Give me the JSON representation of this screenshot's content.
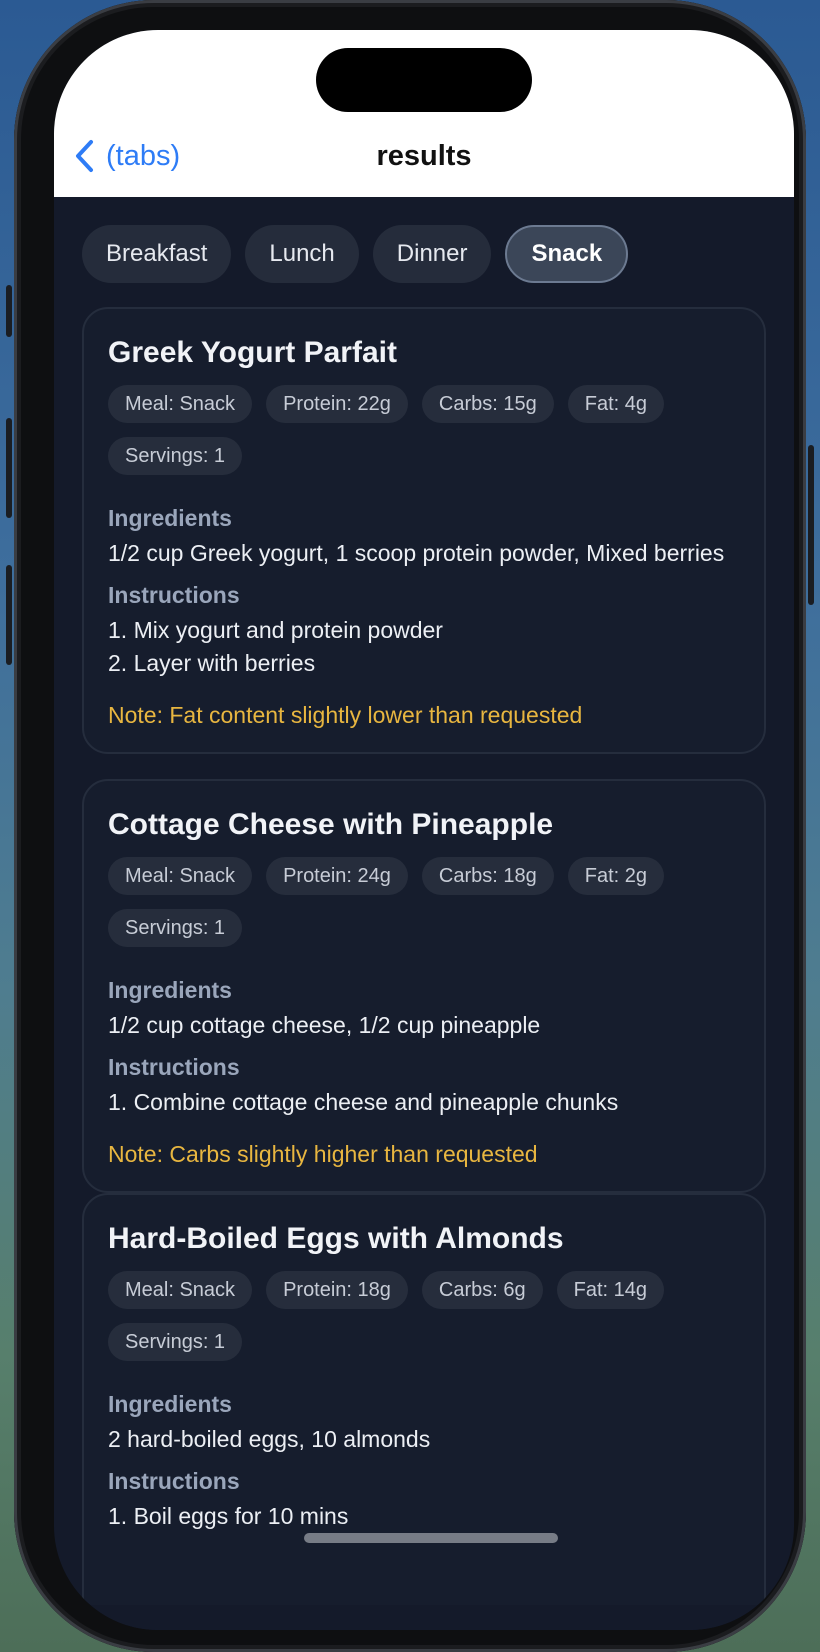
{
  "nav": {
    "back_label": "(tabs)",
    "title": "results"
  },
  "tabs": [
    {
      "label": "Breakfast",
      "active": false
    },
    {
      "label": "Lunch",
      "active": false
    },
    {
      "label": "Dinner",
      "active": false
    },
    {
      "label": "Snack",
      "active": true
    }
  ],
  "cards": [
    {
      "title": "Greek Yogurt Parfait",
      "chips": [
        "Meal: Snack",
        "Protein: 22g",
        "Carbs: 15g",
        "Fat: 4g",
        "Servings: 1"
      ],
      "ingredients_heading": "Ingredients",
      "ingredients": "1/2 cup Greek yogurt, 1 scoop protein powder, Mixed berries",
      "instructions_heading": "Instructions",
      "instructions": [
        "1. Mix yogurt and protein powder",
        "2. Layer with berries"
      ],
      "note": "Note: Fat content slightly lower than requested"
    },
    {
      "title": "Cottage Cheese with Pineapple",
      "chips": [
        "Meal: Snack",
        "Protein: 24g",
        "Carbs: 18g",
        "Fat: 2g",
        "Servings: 1"
      ],
      "ingredients_heading": "Ingredients",
      "ingredients": "1/2 cup cottage cheese, 1/2 cup pineapple",
      "instructions_heading": "Instructions",
      "instructions": [
        "1. Combine cottage cheese and pineapple chunks"
      ],
      "note": "Note: Carbs slightly higher than requested"
    },
    {
      "title": "Hard-Boiled Eggs with Almonds",
      "chips": [
        "Meal: Snack",
        "Protein: 18g",
        "Carbs: 6g",
        "Fat: 14g",
        "Servings: 1"
      ],
      "ingredients_heading": "Ingredients",
      "ingredients": "2 hard-boiled eggs, 10 almonds",
      "instructions_heading": "Instructions",
      "instructions": [
        "1. Boil eggs for 10 mins"
      ],
      "note": ""
    }
  ],
  "colors": {
    "accent": "#2e7cf6",
    "note": "#e8b640",
    "background": "#141a2a",
    "card": "#161d2d"
  }
}
